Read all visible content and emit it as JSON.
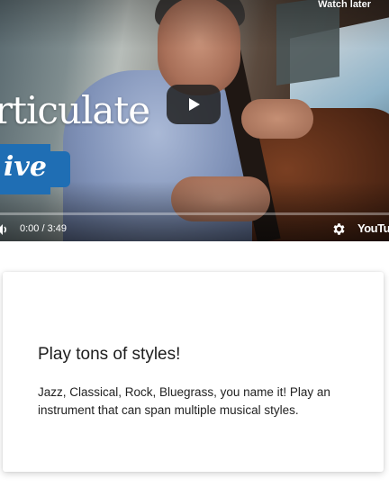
{
  "video": {
    "watch_later": "Watch later",
    "brand_title": "rticulate",
    "live_badge": "ive",
    "time": "0:00 / 3:49",
    "youtube_logo": "YouTub",
    "colors": {
      "accent_blue": "#1f6eb4"
    }
  },
  "card": {
    "title": "Play tons of styles!",
    "body": "Jazz, Classical, Rock, Bluegrass, you name it! Play an instrument that can span multiple musical styles."
  }
}
